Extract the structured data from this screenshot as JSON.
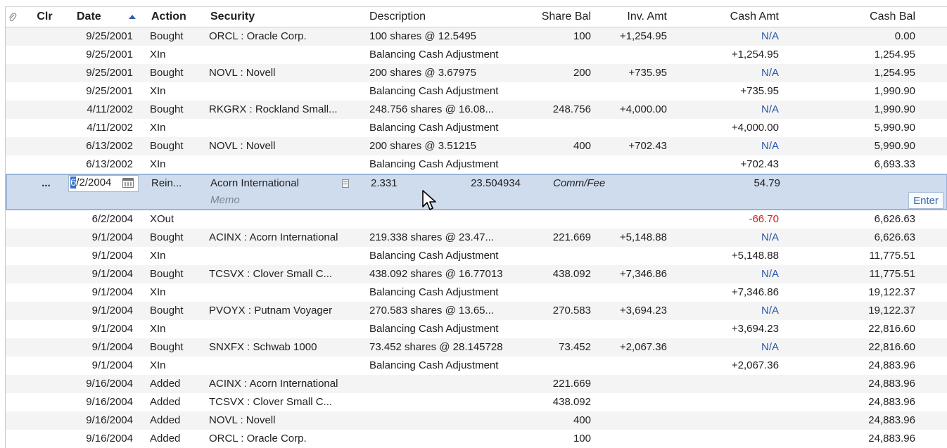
{
  "header": {
    "clr": "Clr",
    "date": "Date",
    "action": "Action",
    "security": "Security",
    "description": "Description",
    "share_bal": "Share Bal",
    "inv_amt": "Inv. Amt",
    "cash_amt": "Cash Amt",
    "cash_bal": "Cash Bal"
  },
  "rows_top": [
    {
      "date": "9/25/2001",
      "action": "Bought",
      "security": "ORCL : Oracle Corp.",
      "desc": "100 shares @ 12.5495",
      "share": "100",
      "inv": "+1,254.95",
      "cash": "N/A",
      "bal": "0.00"
    },
    {
      "date": "9/25/2001",
      "action": "XIn",
      "security": "",
      "desc": "Balancing Cash Adjustment",
      "share": "",
      "inv": "",
      "cash": "+1,254.95",
      "bal": "1,254.95"
    },
    {
      "date": "9/25/2001",
      "action": "Bought",
      "security": "NOVL : Novell",
      "desc": "200 shares @ 3.67975",
      "share": "200",
      "inv": "+735.95",
      "cash": "N/A",
      "bal": "1,254.95"
    },
    {
      "date": "9/25/2001",
      "action": "XIn",
      "security": "",
      "desc": "Balancing Cash Adjustment",
      "share": "",
      "inv": "",
      "cash": "+735.95",
      "bal": "1,990.90"
    },
    {
      "date": "4/11/2002",
      "action": "Bought",
      "security": "RKGRX : Rockland Small...",
      "desc": "248.756 shares @ 16.08...",
      "share": "248.756",
      "inv": "+4,000.00",
      "cash": "N/A",
      "bal": "1,990.90"
    },
    {
      "date": "4/11/2002",
      "action": "XIn",
      "security": "",
      "desc": "Balancing Cash Adjustment",
      "share": "",
      "inv": "",
      "cash": "+4,000.00",
      "bal": "5,990.90"
    },
    {
      "date": "6/13/2002",
      "action": "Bought",
      "security": "NOVL : Novell",
      "desc": "200 shares @ 3.51215",
      "share": "400",
      "inv": "+702.43",
      "cash": "N/A",
      "bal": "5,990.90"
    },
    {
      "date": "6/13/2002",
      "action": "XIn",
      "security": "",
      "desc": "Balancing Cash Adjustment",
      "share": "",
      "inv": "",
      "cash": "+702.43",
      "bal": "6,693.33"
    }
  ],
  "edit": {
    "clr": "...",
    "date_selected": "6",
    "date_rest": "/2/2004",
    "action": "Rein...",
    "security": "Acorn International",
    "shares": "2.331",
    "price": "23.504934",
    "comm_label": "Comm/Fee",
    "amount": "54.79",
    "memo": "Memo",
    "enter": "Enter"
  },
  "rows_bottom": [
    {
      "date": "6/2/2004",
      "action": "XOut",
      "security": "",
      "desc": "",
      "share": "",
      "inv": "",
      "cash": "-66.70",
      "bal": "6,626.63"
    },
    {
      "date": "9/1/2004",
      "action": "Bought",
      "security": "ACINX : Acorn International",
      "desc": "219.338 shares @ 23.47...",
      "share": "221.669",
      "inv": "+5,148.88",
      "cash": "N/A",
      "bal": "6,626.63"
    },
    {
      "date": "9/1/2004",
      "action": "XIn",
      "security": "",
      "desc": "Balancing Cash Adjustment",
      "share": "",
      "inv": "",
      "cash": "+5,148.88",
      "bal": "11,775.51"
    },
    {
      "date": "9/1/2004",
      "action": "Bought",
      "security": "TCSVX : Clover Small C...",
      "desc": "438.092 shares @ 16.77013",
      "share": "438.092",
      "inv": "+7,346.86",
      "cash": "N/A",
      "bal": "11,775.51"
    },
    {
      "date": "9/1/2004",
      "action": "XIn",
      "security": "",
      "desc": "Balancing Cash Adjustment",
      "share": "",
      "inv": "",
      "cash": "+7,346.86",
      "bal": "19,122.37"
    },
    {
      "date": "9/1/2004",
      "action": "Bought",
      "security": "PVOYX : Putnam Voyager",
      "desc": "270.583 shares @ 13.65...",
      "share": "270.583",
      "inv": "+3,694.23",
      "cash": "N/A",
      "bal": "19,122.37"
    },
    {
      "date": "9/1/2004",
      "action": "XIn",
      "security": "",
      "desc": "Balancing Cash Adjustment",
      "share": "",
      "inv": "",
      "cash": "+3,694.23",
      "bal": "22,816.60"
    },
    {
      "date": "9/1/2004",
      "action": "Bought",
      "security": "SNXFX : Schwab 1000",
      "desc": "73.452 shares @ 28.145728",
      "share": "73.452",
      "inv": "+2,067.36",
      "cash": "N/A",
      "bal": "22,816.60"
    },
    {
      "date": "9/1/2004",
      "action": "XIn",
      "security": "",
      "desc": "Balancing Cash Adjustment",
      "share": "",
      "inv": "",
      "cash": "+2,067.36",
      "bal": "24,883.96"
    },
    {
      "date": "9/16/2004",
      "action": "Added",
      "security": "ACINX : Acorn International",
      "desc": "",
      "share": "221.669",
      "inv": "",
      "cash": "",
      "bal": "24,883.96"
    },
    {
      "date": "9/16/2004",
      "action": "Added",
      "security": "TCSVX : Clover Small C...",
      "desc": "",
      "share": "438.092",
      "inv": "",
      "cash": "",
      "bal": "24,883.96"
    },
    {
      "date": "9/16/2004",
      "action": "Added",
      "security": "NOVL : Novell",
      "desc": "",
      "share": "400",
      "inv": "",
      "cash": "",
      "bal": "24,883.96"
    },
    {
      "date": "9/16/2004",
      "action": "Added",
      "security": "ORCL : Oracle Corp.",
      "desc": "",
      "share": "100",
      "inv": "",
      "cash": "",
      "bal": "24,883.96"
    }
  ],
  "colors": {
    "na_blue": "#2a57a8",
    "negative_red": "#d02020",
    "edit_bg": "#cfdcee"
  },
  "icons": {
    "attachment": "paperclip-icon",
    "sort": "sort-ascending-icon",
    "calendar": "calendar-icon",
    "memo": "memo-icon",
    "cursor": "mouse-pointer-icon"
  }
}
